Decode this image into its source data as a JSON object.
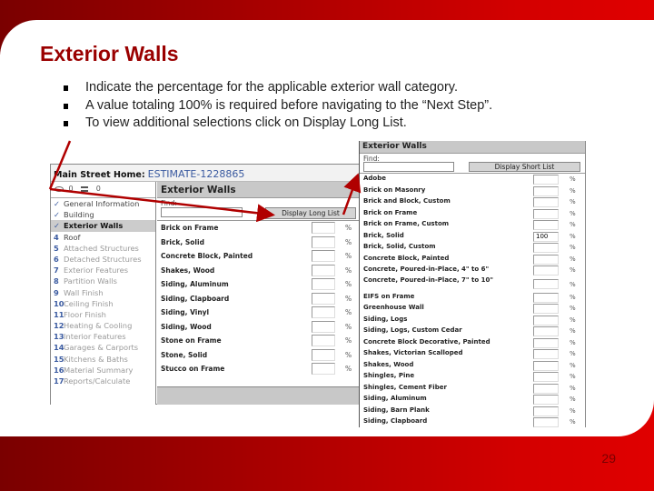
{
  "slide": {
    "title": "Exterior Walls",
    "bullets": [
      "Indicate the percentage for the applicable exterior wall category.",
      "A value totaling 100% is required before navigating to the “Next Step”.",
      "To view additional selections click on Display Long List."
    ],
    "page_number": "29",
    "accent_color": "#9a0000"
  },
  "app": {
    "home_label": "Main Street Home:",
    "estimate_id": "ESTIMATE-1228865",
    "counters": {
      "comments_icon": "speech-bubble-icon",
      "comments_count": "0",
      "list_icon": "list-icon",
      "list_count": "0"
    },
    "nav": [
      {
        "num": "✓",
        "label": "General Information",
        "state": "done"
      },
      {
        "num": "✓",
        "label": "Building",
        "state": "done"
      },
      {
        "num": "✓",
        "label": "Exterior Walls",
        "state": "active"
      },
      {
        "num": "4",
        "label": "Roof",
        "state": "done"
      },
      {
        "num": "5",
        "label": "Attached Structures",
        "state": "pending"
      },
      {
        "num": "6",
        "label": "Detached Structures",
        "state": "pending"
      },
      {
        "num": "7",
        "label": "Exterior Features",
        "state": "pending"
      },
      {
        "num": "8",
        "label": "Partition Walls",
        "state": "pending"
      },
      {
        "num": "9",
        "label": "Wall Finish",
        "state": "pending"
      },
      {
        "num": "10",
        "label": "Ceiling Finish",
        "state": "pending"
      },
      {
        "num": "11",
        "label": "Floor Finish",
        "state": "pending"
      },
      {
        "num": "12",
        "label": "Heating & Cooling",
        "state": "pending"
      },
      {
        "num": "13",
        "label": "Interior Features",
        "state": "pending"
      },
      {
        "num": "14",
        "label": "Garages & Carports",
        "state": "pending"
      },
      {
        "num": "15",
        "label": "Kitchens & Baths",
        "state": "pending"
      },
      {
        "num": "16",
        "label": "Material Summary",
        "state": "pending"
      },
      {
        "num": "17",
        "label": "Reports/Calculate",
        "state": "pending"
      }
    ],
    "short_list": {
      "title": "Exterior Walls",
      "find_label": "Find:",
      "find_value": "",
      "toggle_button": "Display Long List",
      "pct_symbol": "%",
      "items": [
        {
          "label": "Brick on Frame",
          "value": ""
        },
        {
          "label": "Brick, Solid",
          "value": ""
        },
        {
          "label": "Concrete Block, Painted",
          "value": ""
        },
        {
          "label": "Shakes, Wood",
          "value": ""
        },
        {
          "label": "Siding, Aluminum",
          "value": ""
        },
        {
          "label": "Siding, Clapboard",
          "value": ""
        },
        {
          "label": "Siding, Vinyl",
          "value": ""
        },
        {
          "label": "Siding, Wood",
          "value": ""
        },
        {
          "label": "Stone on Frame",
          "value": ""
        },
        {
          "label": "Stone, Solid",
          "value": ""
        },
        {
          "label": "Stucco on Frame",
          "value": ""
        }
      ]
    },
    "long_list": {
      "title": "Exterior Walls",
      "find_label": "Find:",
      "find_value": "",
      "toggle_button": "Display Short List",
      "pct_symbol": "%",
      "items": [
        {
          "label": "Adobe",
          "value": ""
        },
        {
          "label": "Brick on Masonry",
          "value": ""
        },
        {
          "label": "Brick and Block, Custom",
          "value": ""
        },
        {
          "label": "Brick on Frame",
          "value": ""
        },
        {
          "label": "Brick on Frame, Custom",
          "value": ""
        },
        {
          "label": "Brick, Solid",
          "value": "100"
        },
        {
          "label": "Brick, Solid, Custom",
          "value": ""
        },
        {
          "label": "Concrete Block, Painted",
          "value": ""
        },
        {
          "label": "Concrete, Poured-in-Place, 4\" to 6\"",
          "value": ""
        },
        {
          "label": "Concrete, Poured-in-Place, 7\" to 10\"",
          "value": "",
          "tall": true
        },
        {
          "label": "EIFS on Frame",
          "value": ""
        },
        {
          "label": "Greenhouse Wall",
          "value": ""
        },
        {
          "label": "Siding, Logs",
          "value": ""
        },
        {
          "label": "Siding, Logs, Custom Cedar",
          "value": ""
        },
        {
          "label": "Concrete Block Decorative, Painted",
          "value": ""
        },
        {
          "label": "Shakes, Victorian Scalloped",
          "value": ""
        },
        {
          "label": "Shakes, Wood",
          "value": ""
        },
        {
          "label": "Shingles, Pine",
          "value": ""
        },
        {
          "label": "Shingles, Cement Fiber",
          "value": ""
        },
        {
          "label": "Siding, Aluminum",
          "value": ""
        },
        {
          "label": "Siding, Barn Plank",
          "value": ""
        },
        {
          "label": "Siding, Clapboard",
          "value": ""
        }
      ]
    }
  }
}
